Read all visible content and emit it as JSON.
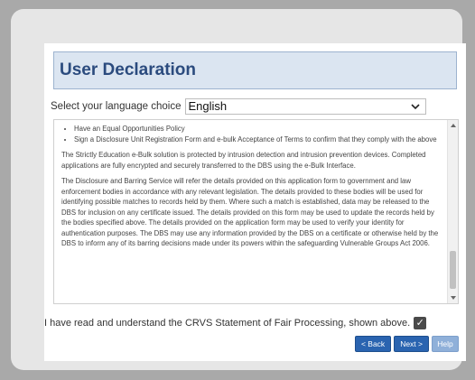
{
  "header": {
    "title": "User Declaration"
  },
  "language": {
    "label": "Select your language choice",
    "selected": "English"
  },
  "declaration": {
    "bullets": [
      "Have an Equal Opportunities Policy",
      "Sign a Disclosure Unit Registration Form and e-bulk Acceptance of Terms to confirm that they comply with the above"
    ],
    "paragraphs": [
      "The Strictly Education e-Bulk solution is protected by intrusion detection and intrusion prevention devices. Completed applications are fully encrypted and securely transferred to the DBS using the e-Bulk Interface.",
      "The Disclosure and Barring Service will refer the details provided on this application form to government and law enforcement bodies in accordance with any relevant legislation. The details provided to these bodies will be used for identifying possible matches to records held by them. Where such a match is established, data may be released to the DBS for inclusion on any certificate issued. The details provided on this form may be used to update the records held by the bodies specified above. The details provided on the application form may be used to verify your identity for authentication purposes. The DBS may use any information provided by the DBS on a certificate or otherwise held by the DBS to inform any of its barring decisions made under its powers within the safeguarding Vulnerable Groups Act 2006."
    ]
  },
  "agreement": {
    "label": "I have read and understand the CRVS Statement of Fair Processing, shown above.",
    "checked": true
  },
  "buttons": {
    "back": "< Back",
    "next": "Next >",
    "help": "Help"
  },
  "icons": {
    "select_chevron": "chevron-down-icon",
    "checkbox_mark": "check-icon"
  }
}
